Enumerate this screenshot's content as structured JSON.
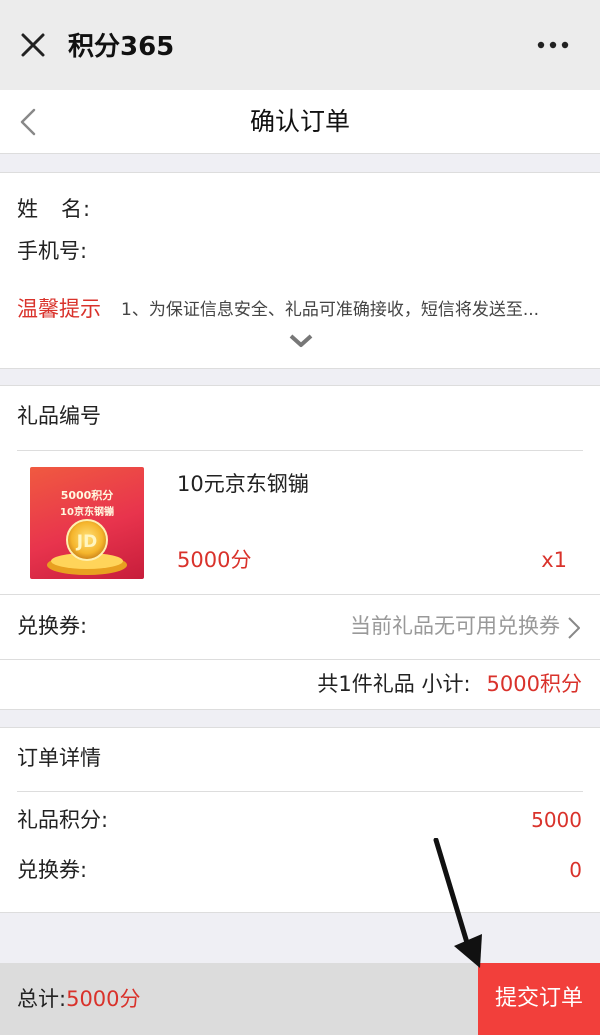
{
  "window": {
    "title": "积分365"
  },
  "header": {
    "title": "确认订单"
  },
  "info": {
    "name_label": "姓　名:",
    "phone_label": "手机号:",
    "tip_label": "温馨提示",
    "tip_text": "1、为保证信息安全、礼品可准确接收，短信将发送至..."
  },
  "gift": {
    "section_title": "礼品编号",
    "item": {
      "name": "10元京东钢镚",
      "price": "5000分",
      "quantity": "x1",
      "thumb_line1": "5000积分",
      "thumb_line2": "10京东钢镚",
      "thumb_coin": "JD"
    },
    "coupon_label": "兑换券:",
    "coupon_value": "当前礼品无可用兑换券",
    "subtotal_label": "共1件礼品 小计:",
    "subtotal_value": "5000积分"
  },
  "order_details": {
    "section_title": "订单详情",
    "rows": [
      {
        "label": "礼品积分:",
        "value": "5000"
      },
      {
        "label": "兑换券:",
        "value": "0"
      }
    ]
  },
  "footer": {
    "total_label": "总计:",
    "total_value": "5000分",
    "submit_label": "提交订单"
  },
  "colors": {
    "accent": "#d9322b",
    "submit_bg": "#f23f3b"
  },
  "icons": [
    "close-icon",
    "more-icon",
    "back-chevron-icon",
    "expand-chevron-icon",
    "chevron-right-icon"
  ]
}
